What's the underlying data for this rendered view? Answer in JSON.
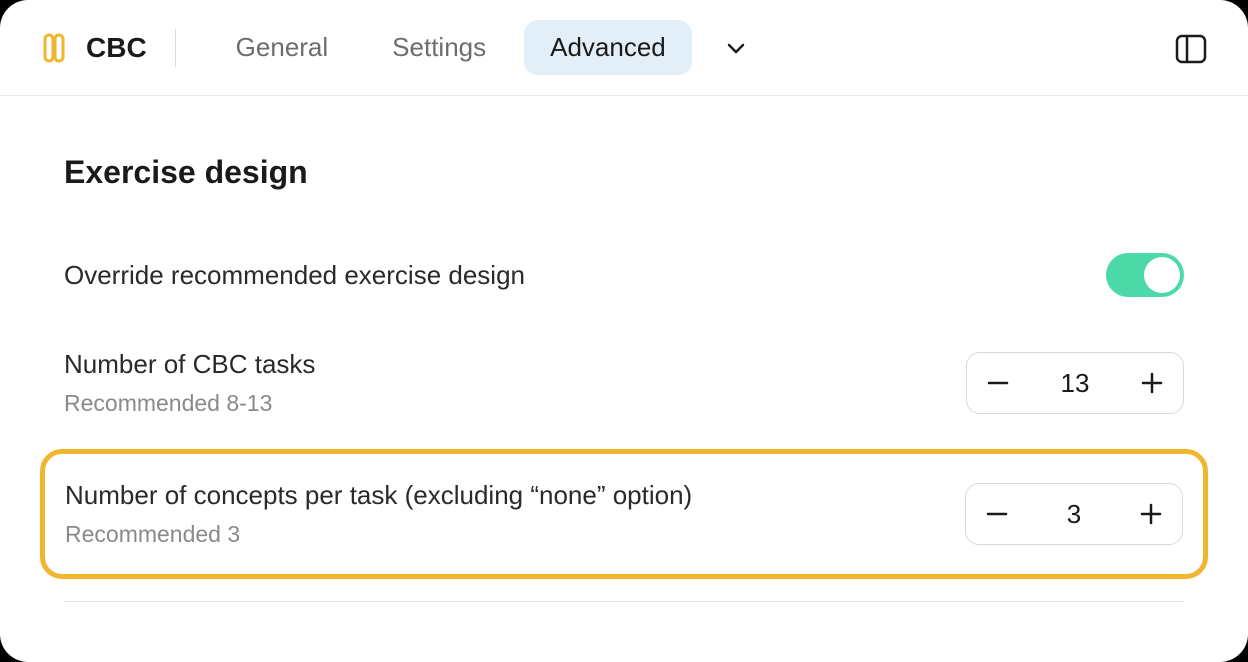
{
  "app": {
    "title": "CBC"
  },
  "tabs": {
    "general": "General",
    "settings": "Settings",
    "advanced": "Advanced"
  },
  "section": {
    "title": "Exercise design"
  },
  "override": {
    "label": "Override recommended exercise design",
    "enabled": true
  },
  "tasks": {
    "label": "Number of CBC tasks",
    "hint": "Recommended 8-13",
    "value": "13"
  },
  "concepts": {
    "label": "Number of concepts per task (excluding “none” option)",
    "hint": "Recommended 3",
    "value": "3"
  },
  "colors": {
    "accent": "#f0b62e",
    "toggle_on": "#4cd9a8",
    "tab_active_bg": "#e2eef8"
  }
}
